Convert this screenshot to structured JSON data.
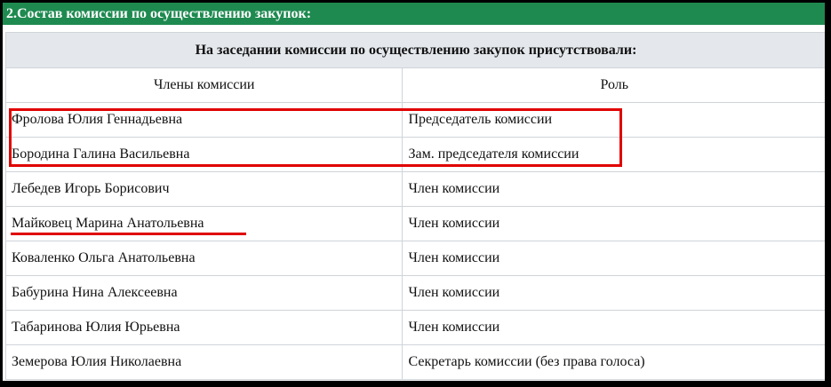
{
  "section": {
    "title": "2.Состав комиссии по осуществлению закупок:"
  },
  "table": {
    "caption": "На заседании комиссии по осуществлению закупок присутствовали:",
    "columns": [
      "Члены комиссии",
      "Роль"
    ],
    "rows": [
      {
        "name": "Фролова Юлия Геннадьевна",
        "role": "Председатель комиссии"
      },
      {
        "name": "Бородина Галина Васильевна",
        "role": "Зам. председателя комиссии"
      },
      {
        "name": "Лебедев Игорь Борисович",
        "role": "Член комиссии"
      },
      {
        "name": "Майковец Марина Анатольевна",
        "role": "Член комиссии"
      },
      {
        "name": "Коваленко Ольга Анатольевна",
        "role": "Член комиссии"
      },
      {
        "name": "Бабурина Нина Алексеевна",
        "role": "Член комиссии"
      },
      {
        "name": "Табаринова Юлия Юрьевна",
        "role": "Член комиссии"
      },
      {
        "name": "Земерова Юлия Николаевна",
        "role": "Секретарь комиссии (без права голоса)"
      }
    ]
  },
  "colors": {
    "header_bg": "#1e8a50",
    "caption_bg": "#e4e8ec",
    "annotation": "#e00000"
  }
}
